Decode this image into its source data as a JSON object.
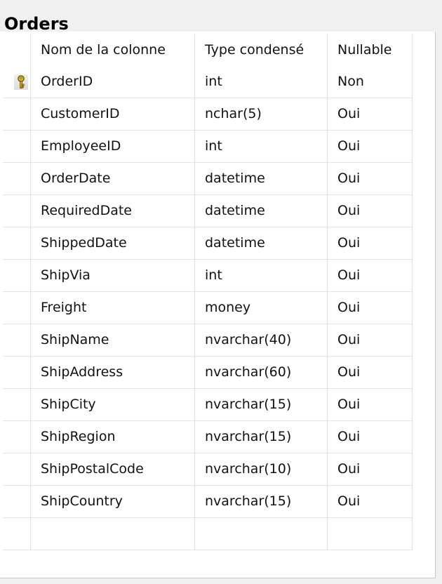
{
  "table": {
    "title": "Orders",
    "columns": [
      "Nom de la colonne",
      "Type condensé",
      "Nullable"
    ],
    "rows": [
      {
        "name": "OrderID",
        "type": "int",
        "nullable": "Non",
        "primary_key": true
      },
      {
        "name": "CustomerID",
        "type": "nchar(5)",
        "nullable": "Oui"
      },
      {
        "name": "EmployeeID",
        "type": "int",
        "nullable": "Oui"
      },
      {
        "name": "OrderDate",
        "type": "datetime",
        "nullable": "Oui"
      },
      {
        "name": "RequiredDate",
        "type": "datetime",
        "nullable": "Oui"
      },
      {
        "name": "ShippedDate",
        "type": "datetime",
        "nullable": "Oui"
      },
      {
        "name": "ShipVia",
        "type": "int",
        "nullable": "Oui"
      },
      {
        "name": "Freight",
        "type": "money",
        "nullable": "Oui"
      },
      {
        "name": "ShipName",
        "type": "nvarchar(40)",
        "nullable": "Oui"
      },
      {
        "name": "ShipAddress",
        "type": "nvarchar(60)",
        "nullable": "Oui"
      },
      {
        "name": "ShipCity",
        "type": "nvarchar(15)",
        "nullable": "Oui"
      },
      {
        "name": "ShipRegion",
        "type": "nvarchar(15)",
        "nullable": "Oui"
      },
      {
        "name": "ShipPostalCode",
        "type": "nvarchar(10)",
        "nullable": "Oui"
      },
      {
        "name": "ShipCountry",
        "type": "nvarchar(15)",
        "nullable": "Oui"
      },
      {
        "name": "",
        "type": "",
        "nullable": ""
      }
    ]
  },
  "icons": {
    "primary_key": "key-icon"
  }
}
